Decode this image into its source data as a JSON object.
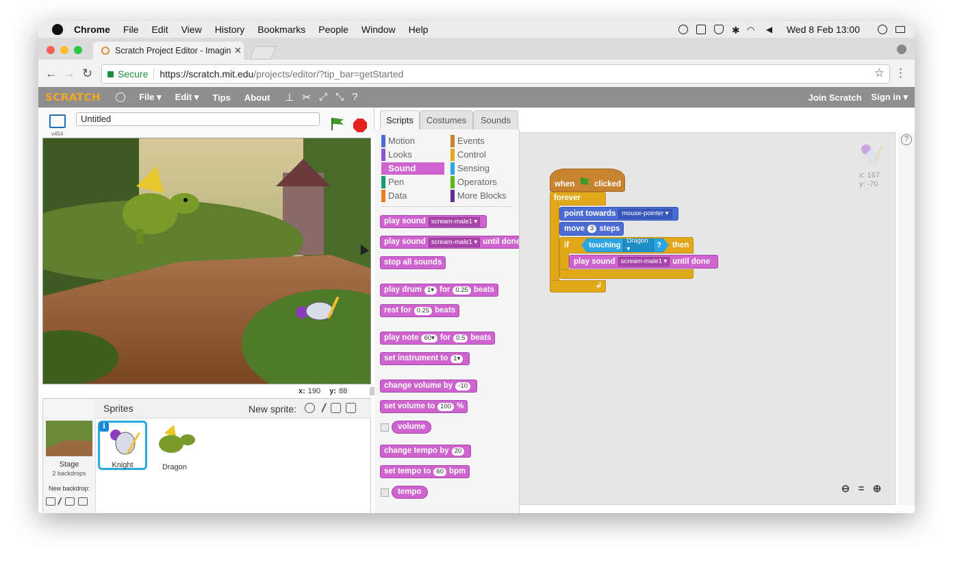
{
  "menubar": {
    "app": "Chrome",
    "items": [
      "File",
      "Edit",
      "View",
      "History",
      "Bookmarks",
      "People",
      "Window",
      "Help"
    ],
    "clock": "Wed 8 Feb  13:00"
  },
  "browser": {
    "tab_title": "Scratch Project Editor - Imagine",
    "secure_label": "Secure",
    "url_host": "https://scratch.mit.edu",
    "url_path": "/projects/editor/?tip_bar=getStarted"
  },
  "scratch_bar": {
    "logo": "SCRATCH",
    "menus": [
      "File ▾",
      "Edit ▾",
      "Tips",
      "About"
    ],
    "join": "Join Scratch",
    "signin": "Sign in ▾"
  },
  "stage_header": {
    "version": "v454",
    "project_title": "Untitled"
  },
  "stage": {
    "mouse_x_label": "x:",
    "mouse_x": "190",
    "mouse_y_label": "y:",
    "mouse_y": "88"
  },
  "sprites_pane": {
    "title": "Sprites",
    "new_sprite": "New sprite:",
    "stage_label": "Stage",
    "stage_sub": "2 backdrops",
    "new_backdrop": "New backdrop:",
    "sprites": [
      {
        "name": "Knight",
        "selected": true
      },
      {
        "name": "Dragon",
        "selected": false
      }
    ]
  },
  "tabs": [
    "Scripts",
    "Costumes",
    "Sounds"
  ],
  "categories": {
    "left": [
      {
        "label": "Motion",
        "color": "#4a6cd4"
      },
      {
        "label": "Looks",
        "color": "#8a55d7"
      },
      {
        "label": "Sound",
        "color": "#cf63cf"
      },
      {
        "label": "Pen",
        "color": "#0e9a6c"
      },
      {
        "label": "Data",
        "color": "#ee7d16"
      }
    ],
    "right": [
      {
        "label": "Events",
        "color": "#c88330"
      },
      {
        "label": "Control",
        "color": "#e1a91a"
      },
      {
        "label": "Sensing",
        "color": "#2ca5e2"
      },
      {
        "label": "Operators",
        "color": "#5cb712"
      },
      {
        "label": "More Blocks",
        "color": "#632d99"
      }
    ],
    "active": "Sound"
  },
  "palette": {
    "play_sound": [
      "play sound",
      "scream-male1 ▾"
    ],
    "play_sound_until": [
      "play sound",
      "scream-male1 ▾",
      "until done"
    ],
    "stop_all": "stop all sounds",
    "play_drum": [
      "play drum",
      "1▾",
      "for",
      "0.25",
      "beats"
    ],
    "rest_for": [
      "rest for",
      "0.25",
      "beats"
    ],
    "play_note": [
      "play note",
      "60▾",
      "for",
      "0.5",
      "beats"
    ],
    "set_instrument": [
      "set instrument to",
      "1▾"
    ],
    "change_volume": [
      "change volume by",
      "-10"
    ],
    "set_volume": [
      "set volume to",
      "100",
      "%"
    ],
    "volume": "volume",
    "change_tempo": [
      "change tempo by",
      "20"
    ],
    "set_tempo": [
      "set tempo to",
      "60",
      "bpm"
    ],
    "tempo": "tempo"
  },
  "script": {
    "hat": [
      "when",
      "clicked"
    ],
    "forever": "forever",
    "point": [
      "point towards",
      "mouse-pointer ▾"
    ],
    "move": [
      "move",
      "3",
      "steps"
    ],
    "if": [
      "if",
      "then"
    ],
    "touching": [
      "touching",
      "Dragon ▾",
      "?"
    ],
    "play": [
      "play sound",
      "scream-male1 ▾",
      "until done"
    ]
  },
  "scripts_area": {
    "sprite_x": "x: 167",
    "sprite_y": "y: -70"
  }
}
